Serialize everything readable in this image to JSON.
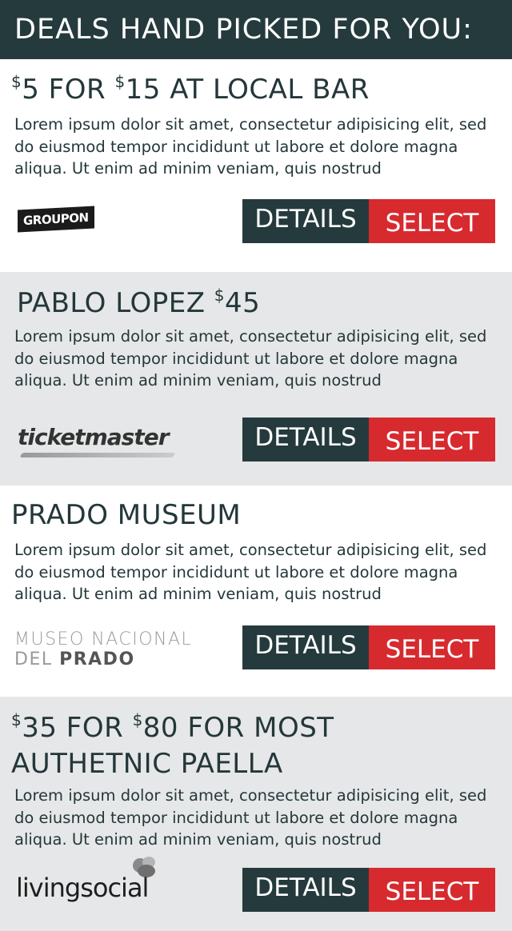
{
  "header": {
    "title": "DEALS HAND PICKED FOR YOU:"
  },
  "deals": [
    {
      "title_parts": [
        "$",
        "5 FOR ",
        "$",
        "15 AT LOCAL BAR"
      ],
      "description": "Lorem ipsum dolor sit amet, consectetur adipisicing elit, sed do eiusmod tempor incididunt ut labore et dolore magna aliqua. Ut enim ad minim veniam, quis nostrud",
      "logo": "GROUPON",
      "details_label": "DETAILS",
      "select_label": "SELECT"
    },
    {
      "title_parts": [
        "PABLO LOPEZ ",
        "$",
        "45"
      ],
      "description": "Lorem ipsum dolor sit amet, consectetur adipisicing elit, sed do eiusmod tempor incididunt ut labore et dolore magna aliqua. Ut enim ad minim veniam, quis nostrud",
      "logo": "ticketmaster",
      "details_label": "DETAILS",
      "select_label": "SELECT"
    },
    {
      "title": "PRADO MUSEUM",
      "description": "Lorem ipsum dolor sit amet, consectetur adipisicing elit, sed do eiusmod tempor incididunt ut labore et dolore magna aliqua. Ut enim ad minim veniam, quis nostrud",
      "logo_line1": "MUSEO NACIONAL",
      "logo_line2a": "DEL ",
      "logo_line2b": "PRADO",
      "details_label": "DETAILS",
      "select_label": "SELECT"
    },
    {
      "title_line1_parts": [
        "$",
        "35 FOR ",
        "$",
        "80 FOR MOST"
      ],
      "title_line2": "AUTHETNIC PAELLA",
      "description": "Lorem ipsum dolor sit amet, consectetur adipisicing elit, sed do eiusmod tempor incididunt ut labore et dolore magna aliqua. Ut enim ad minim veniam, quis nostrud",
      "logo": "livingsocial",
      "details_label": "DETAILS",
      "select_label": "SELECT"
    }
  ],
  "colors": {
    "header_bg": "#253a3d",
    "details_bg": "#253a3d",
    "select_bg": "#d72a2f",
    "alt_row_bg": "#e6e7e8",
    "text": "#24373a"
  },
  "icons": [
    "groupon-logo",
    "ticketmaster-logo",
    "museo-prado-logo",
    "livingsocial-logo"
  ]
}
